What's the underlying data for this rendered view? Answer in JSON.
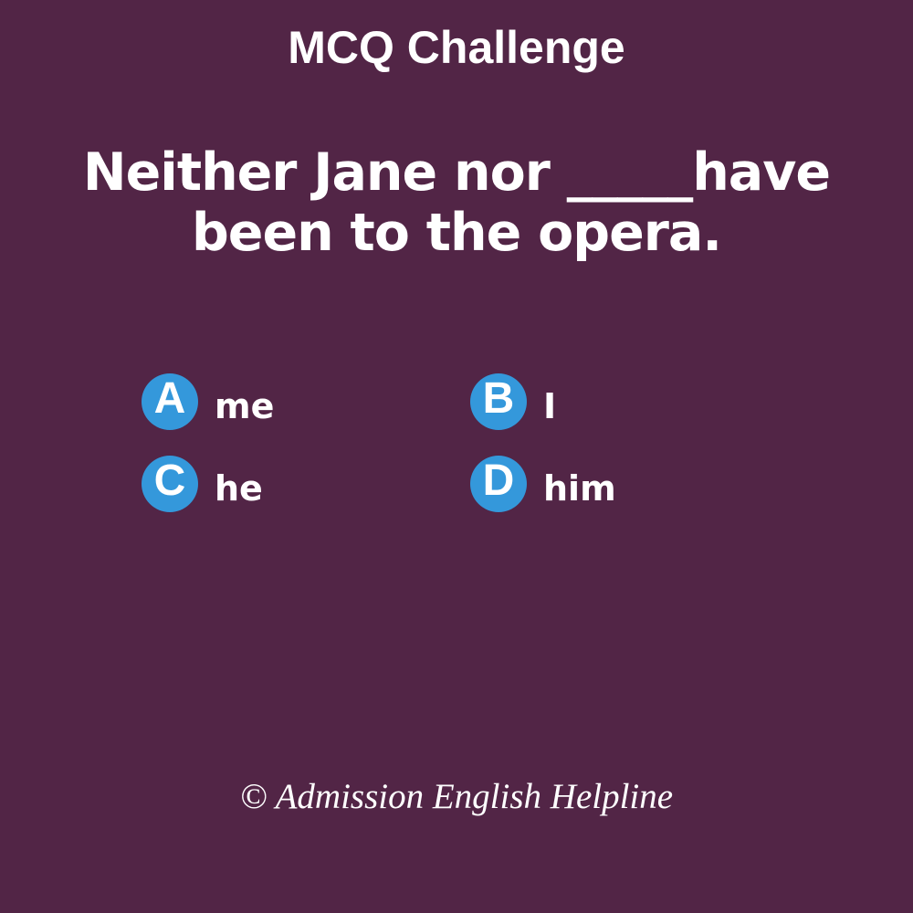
{
  "title": "MCQ Challenge",
  "question": {
    "line1": "Neither Jane nor _____have",
    "line2": "been to the opera."
  },
  "options": [
    {
      "letter": "A",
      "text": "me"
    },
    {
      "letter": "B",
      "text": "I"
    },
    {
      "letter": "C",
      "text": "he"
    },
    {
      "letter": "D",
      "text": "him"
    }
  ],
  "footer": "© Admission English Helpline",
  "colors": {
    "background": "#522546",
    "badge": "#3498db",
    "text": "#ffffff"
  }
}
